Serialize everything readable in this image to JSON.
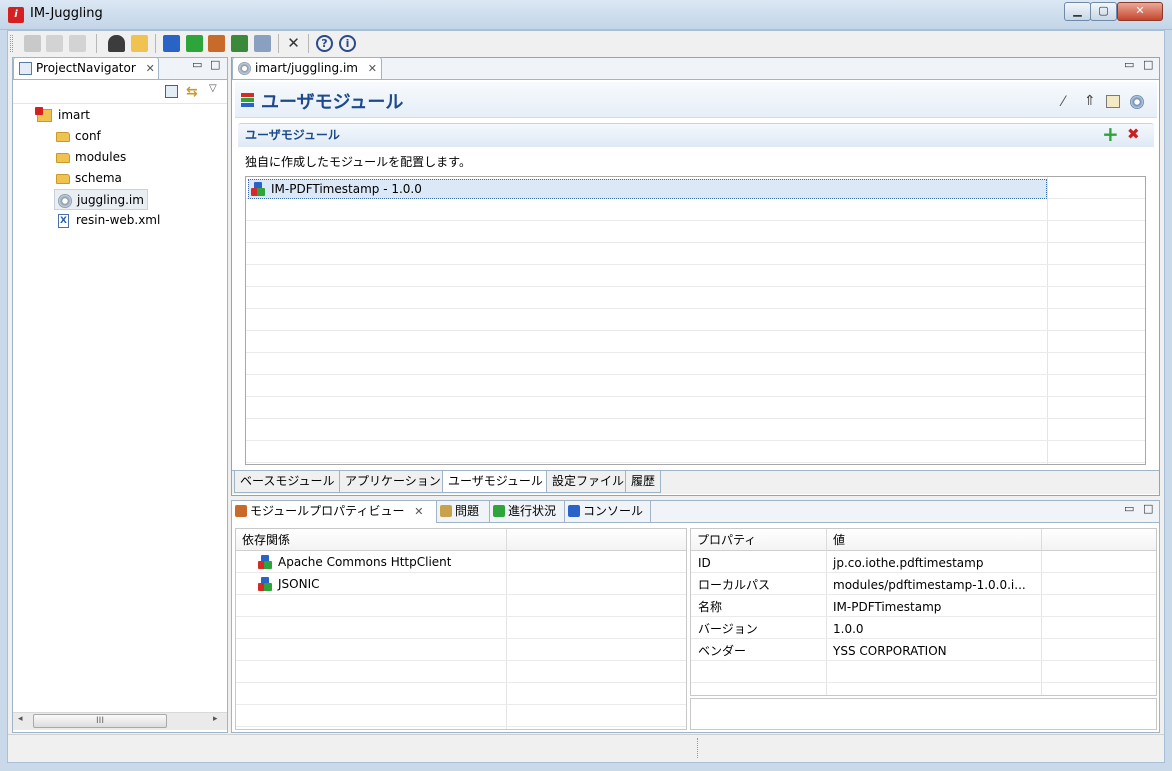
{
  "window": {
    "title": "IM-Juggling"
  },
  "navigator": {
    "tab_label": "ProjectNavigator",
    "tree": [
      {
        "label": "imart",
        "type": "project",
        "indent": 0
      },
      {
        "label": "conf",
        "type": "folder",
        "indent": 1
      },
      {
        "label": "modules",
        "type": "folder",
        "indent": 1
      },
      {
        "label": "schema",
        "type": "folder",
        "indent": 1
      },
      {
        "label": "juggling.im",
        "type": "gear",
        "indent": 1,
        "selected": true
      },
      {
        "label": "resin-web.xml",
        "type": "xml",
        "indent": 1
      }
    ],
    "scroll_grip": "III"
  },
  "editor": {
    "tab_label": "imart/juggling.im",
    "header_title": "ユーザモジュール",
    "section_title": "ユーザモジュール",
    "description": "独自に作成したモジュールを配置します。",
    "modules": [
      "IM-PDFTimestamp - 1.0.0"
    ],
    "bottom_tabs": [
      "ベースモジュール",
      "アプリケーション",
      "ユーザモジュール",
      "設定ファイル",
      "履歴"
    ],
    "active_bottom_tab": 2
  },
  "views": {
    "tabs": [
      "モジュールプロパティビュー",
      "問題",
      "進行状況",
      "コンソール"
    ],
    "dependencies": {
      "header": "依存関係",
      "items": [
        "Apache Commons HttpClient",
        "JSONIC"
      ]
    },
    "properties": {
      "col_property": "プロパティ",
      "col_value": "値",
      "rows": [
        {
          "key": "ID",
          "value": "jp.co.iothe.pdftimestamp"
        },
        {
          "key": "ローカルパス",
          "value": "modules/pdftimestamp-1.0.0.i..."
        },
        {
          "key": "名称",
          "value": "IM-PDFTimestamp"
        },
        {
          "key": "バージョン",
          "value": "1.0.0"
        },
        {
          "key": "ベンダー",
          "value": "YSS CORPORATION"
        }
      ]
    }
  },
  "colors": {
    "accent": "#1c4a8a",
    "selection": "#dbe8f8",
    "add": "#2da53a",
    "delete": "#cc2020"
  }
}
